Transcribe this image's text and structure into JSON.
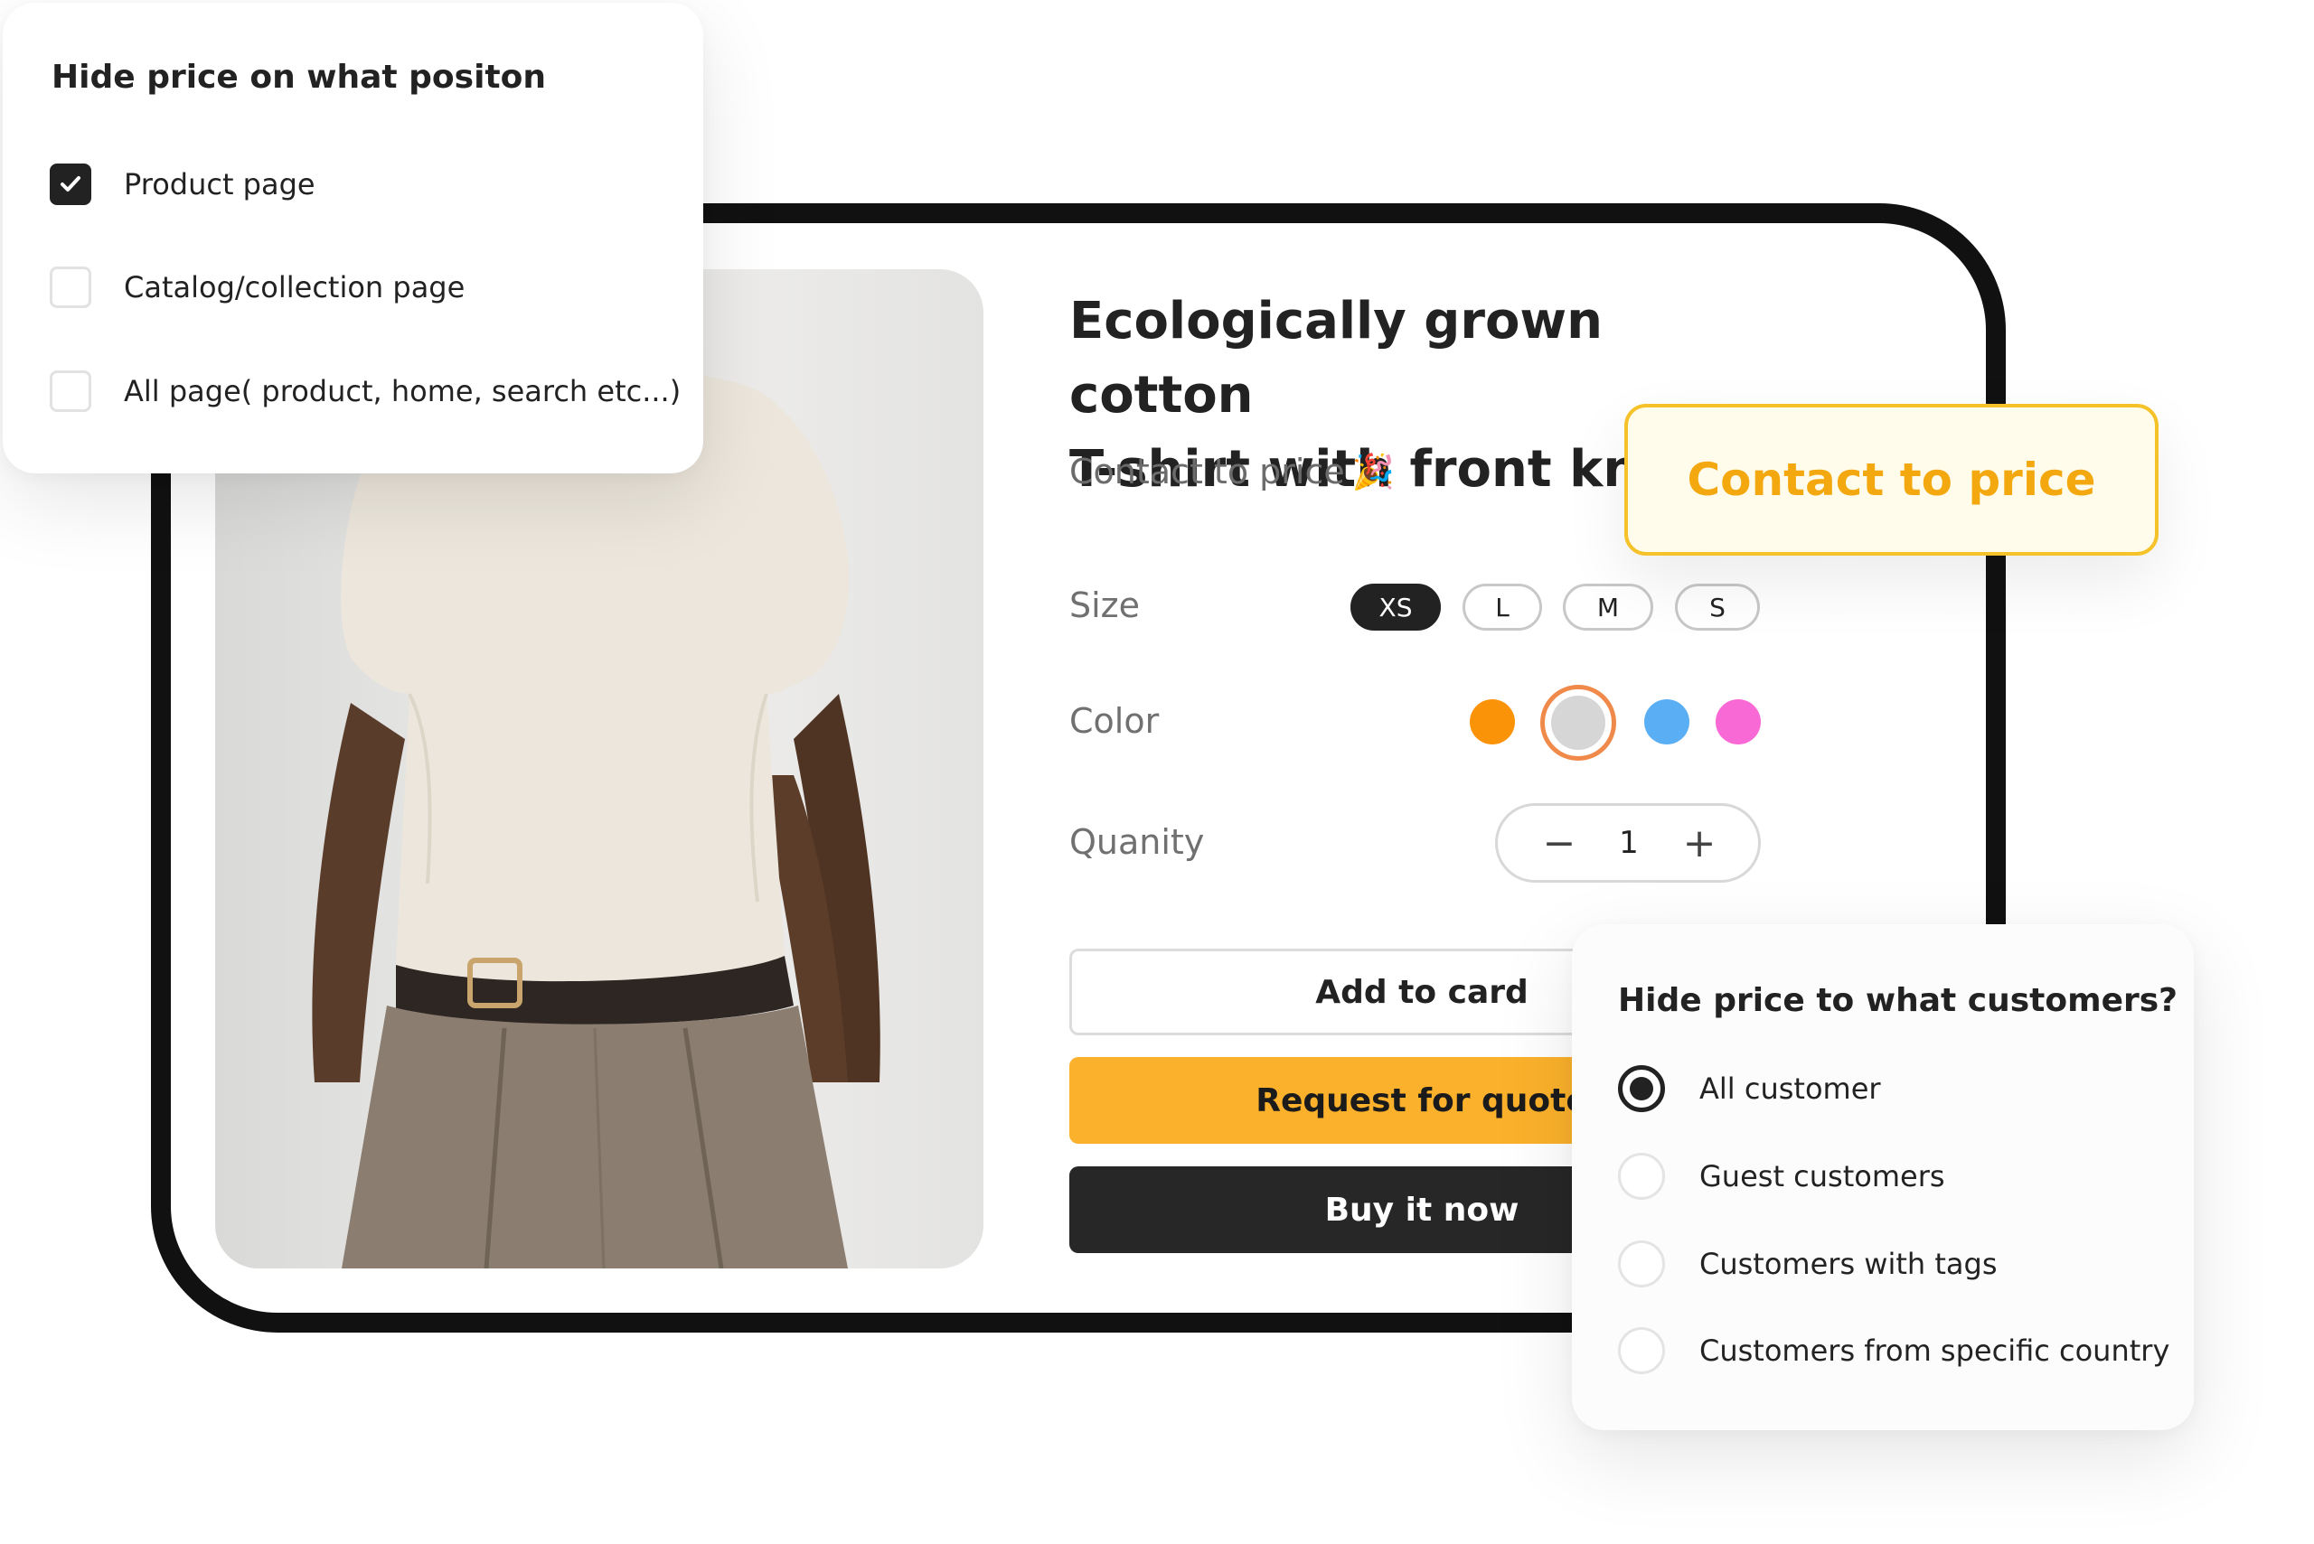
{
  "product": {
    "title_line1": "Ecologically grown cotton",
    "title_line2": "T-shirt with front knot",
    "price_text": "Contact to price",
    "party_emoji": "🎉",
    "image_icon": "tshirt-model-photo"
  },
  "options": {
    "size_label": "Size",
    "sizes": [
      "XS",
      "L",
      "M",
      "S"
    ],
    "selected_size": "XS",
    "color_label": "Color",
    "colors": [
      "#fb9308",
      "#d6d6d6",
      "#5aaef3",
      "#f969d5"
    ],
    "selected_color": "#d6d6d6",
    "selected_color_ring": "#f08a4b",
    "quantity_label": "Quanity",
    "quantity": "1",
    "minus_symbol": "−",
    "plus_symbol": "+"
  },
  "buttons": {
    "add_to_card": "Add to card",
    "request_quote": "Request for quote",
    "buy_now": "Buy it now"
  },
  "position_card": {
    "title": "Hide price on what positon",
    "options": [
      {
        "label": "Product page",
        "checked": true
      },
      {
        "label": "Catalog/collection page",
        "checked": false
      },
      {
        "label": "All page( product, home, search etc...)",
        "checked": false
      }
    ]
  },
  "customers_card": {
    "title": "Hide price to what customers?",
    "options": [
      {
        "label": "All customer",
        "selected": true
      },
      {
        "label": "Guest customers",
        "selected": false
      },
      {
        "label": "Customers with tags",
        "selected": false
      },
      {
        "label": "Customers from specific country",
        "selected": false
      }
    ]
  },
  "badge": {
    "text": "Contact to price",
    "text_color": "#f3a80f",
    "border_color": "#f6c22a"
  },
  "colors": {
    "accent_yellow": "#fbb12b",
    "dark": "#272727"
  }
}
